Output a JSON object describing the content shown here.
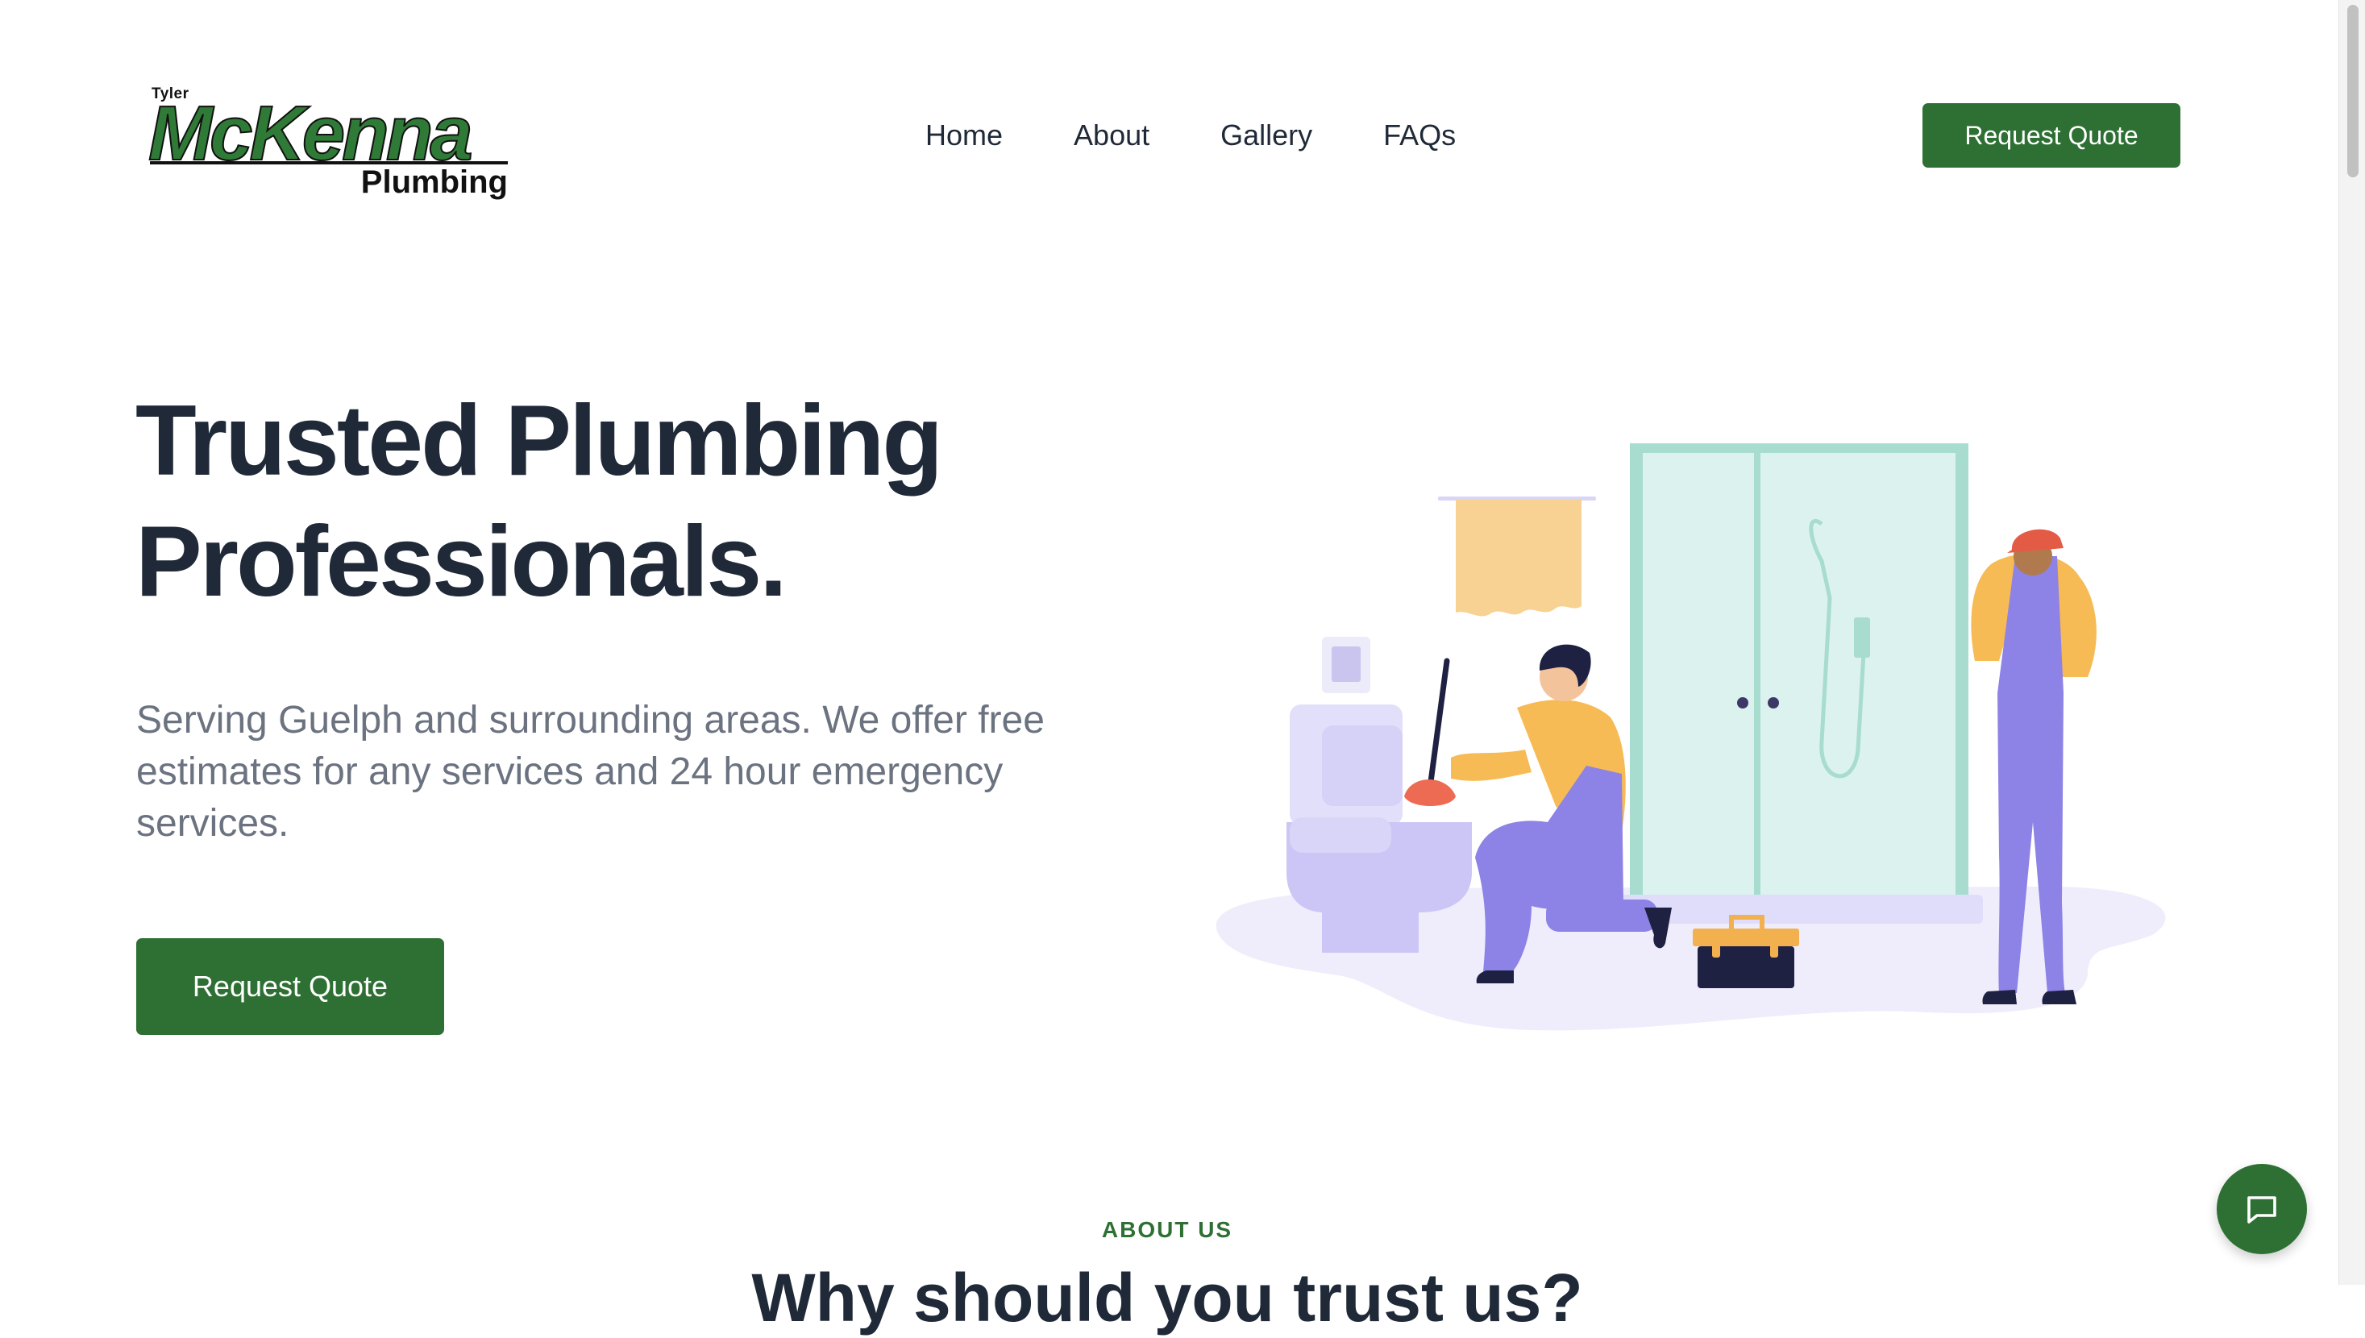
{
  "brand": {
    "top": "Tyler",
    "name": "McKenna",
    "sub": "Plumbing",
    "color": "#2e7033"
  },
  "nav": {
    "items": [
      "Home",
      "About",
      "Gallery",
      "FAQs"
    ],
    "cta": "Request Quote"
  },
  "hero": {
    "title_line1": "Trusted Plumbing",
    "title_line2": "Professionals.",
    "subtitle": "Serving Guelph and surrounding areas. We offer free estimates for any services and 24 hour emergency services.",
    "cta": "Request Quote"
  },
  "about": {
    "label": "ABOUT US",
    "heading": "Why should you trust us?"
  },
  "icons": {
    "chat": "chat-bubble-icon"
  }
}
